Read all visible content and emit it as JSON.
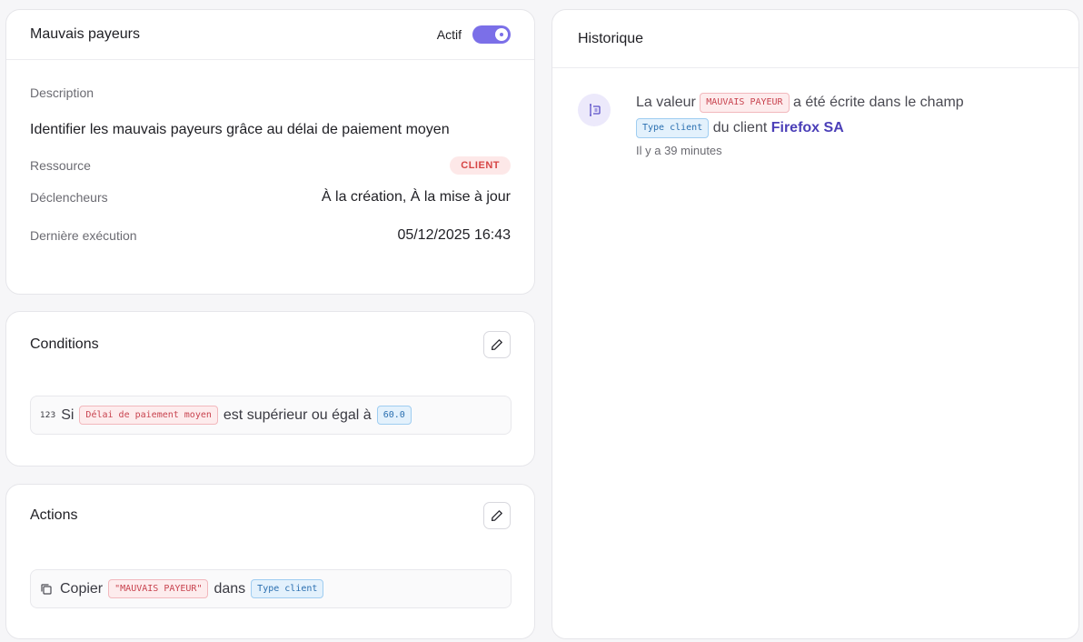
{
  "rule": {
    "title": "Mauvais payeurs",
    "status_label": "Actif",
    "active": true,
    "description_label": "Description",
    "description": "Identifier les mauvais payeurs grâce au délai de paiement moyen",
    "resource_label": "Ressource",
    "resource": "CLIENT",
    "triggers_label": "Déclencheurs",
    "triggers": "À la création, À la mise à jour",
    "last_run_label": "Dernière exécution",
    "last_run": "05/12/2025 16:43"
  },
  "conditions": {
    "title": "Conditions",
    "type_icon": "123",
    "prefix": "Si",
    "field": "Délai de paiement moyen",
    "operator": "est supérieur ou égal à",
    "value": "60.0"
  },
  "actions": {
    "title": "Actions",
    "verb": "Copier",
    "value": "\"MAUVAIS PAYEUR\"",
    "connector": "dans",
    "target": "Type client"
  },
  "history": {
    "title": "Historique",
    "items": [
      {
        "text_before": "La valeur",
        "value": "MAUVAIS PAYEUR",
        "text_middle": "a été écrite dans le champ",
        "field": "Type client",
        "text_client": "du client",
        "client": "Firefox SA",
        "time": "Il y a 39 minutes"
      }
    ]
  },
  "colors": {
    "accent": "#7b6fe8",
    "red_tag": "#c8434f",
    "blue_tag": "#2a6fb0",
    "client_link": "#4b3fb8"
  }
}
